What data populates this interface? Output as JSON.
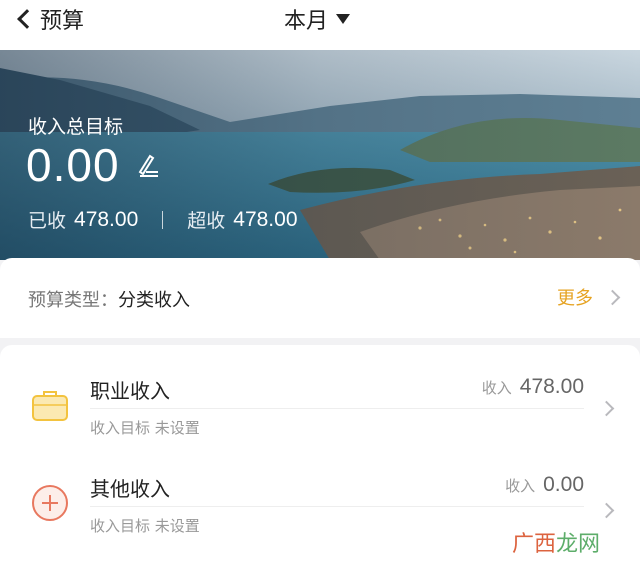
{
  "header": {
    "back_label": "预算",
    "period_label": "本月"
  },
  "hero": {
    "goal_title": "收入总目标",
    "goal_amount": "0.00",
    "received_label": "已收",
    "received_value": "478.00",
    "exceed_label": "超收",
    "exceed_value": "478.00"
  },
  "budget_type": {
    "label": "预算类型：",
    "value": "分类收入",
    "more_label": "更多"
  },
  "categories": [
    {
      "name": "职业收入",
      "amount_label": "收入",
      "amount_value": "478.00",
      "target_label": "收入目标",
      "target_status": "未设置",
      "icon": "briefcase-icon",
      "icon_color": "#f3c33f"
    },
    {
      "name": "其他收入",
      "amount_label": "收入",
      "amount_value": "0.00",
      "target_label": "收入目标",
      "target_status": "未设置",
      "icon": "plus-circle-icon",
      "icon_color": "#e8785f"
    }
  ],
  "watermark": {
    "part1": "广西",
    "part2": "龙网"
  },
  "colors": {
    "accent": "#e6a322",
    "text_primary": "#222222",
    "text_secondary": "#999999"
  }
}
